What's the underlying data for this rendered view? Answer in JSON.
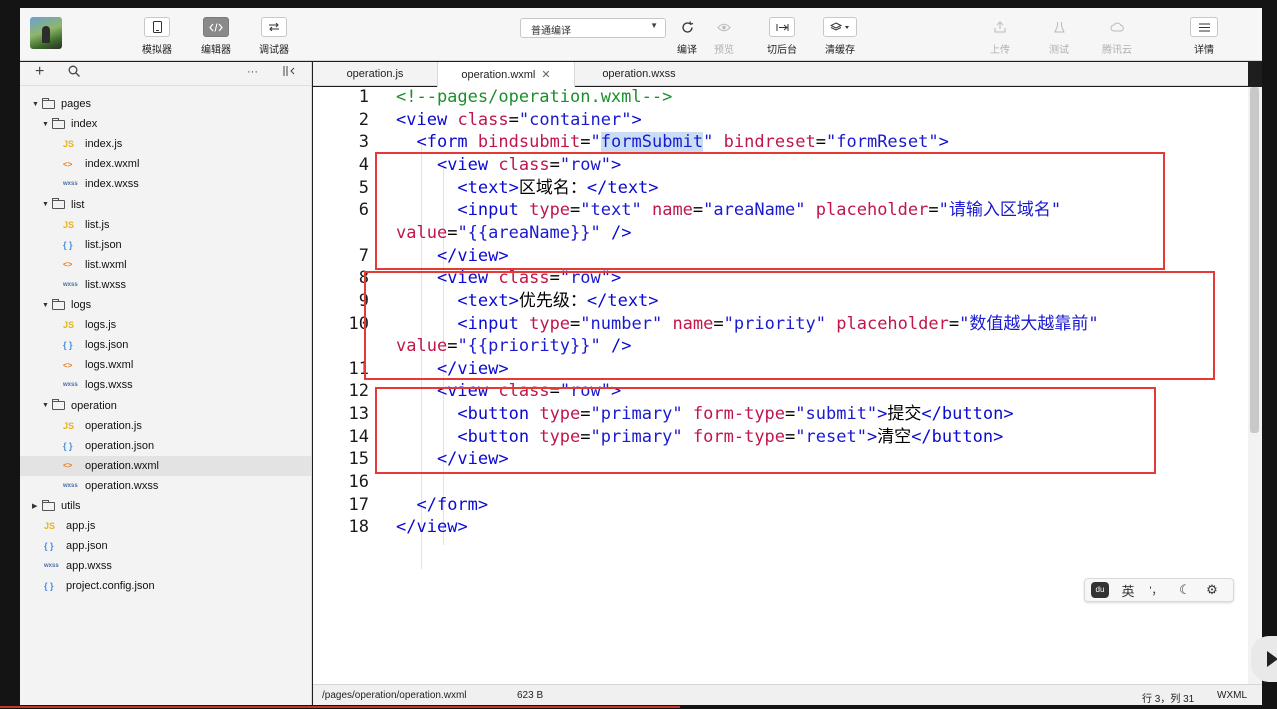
{
  "toolbar": {
    "buttons": [
      {
        "label": "模拟器",
        "icon": "phone-icon"
      },
      {
        "label": "编辑器",
        "icon": "code-icon"
      },
      {
        "label": "调试器",
        "icon": "debug-icon"
      },
      {
        "label": "编译",
        "icon": "refresh-icon"
      },
      {
        "label": "预览",
        "icon": "eye-icon"
      },
      {
        "label": "切后台",
        "icon": "switch-background-icon"
      },
      {
        "label": "清缓存",
        "icon": "layers-icon"
      },
      {
        "label": "上传",
        "icon": "upload-icon"
      },
      {
        "label": "测试",
        "icon": "flask-icon"
      },
      {
        "label": "腾讯云",
        "icon": "cloud-icon"
      },
      {
        "label": "详情",
        "icon": "menu-icon"
      }
    ],
    "compile_mode": "普通编译"
  },
  "sidebar": {
    "add_icon": "+",
    "search_icon": "search-icon",
    "more_icon": "···",
    "split_icon": "split-icon",
    "tree": [
      {
        "label": "pages",
        "type": "folder",
        "expanded": true
      },
      {
        "label": "index",
        "type": "folder",
        "expanded": true
      },
      {
        "label": "index.js",
        "type": "js"
      },
      {
        "label": "index.wxml",
        "type": "wxml"
      },
      {
        "label": "index.wxss",
        "type": "wxss"
      },
      {
        "label": "list",
        "type": "folder",
        "expanded": true
      },
      {
        "label": "list.js",
        "type": "js"
      },
      {
        "label": "list.json",
        "type": "json"
      },
      {
        "label": "list.wxml",
        "type": "wxml"
      },
      {
        "label": "list.wxss",
        "type": "wxss"
      },
      {
        "label": "logs",
        "type": "folder",
        "expanded": true
      },
      {
        "label": "logs.js",
        "type": "js"
      },
      {
        "label": "logs.json",
        "type": "json"
      },
      {
        "label": "logs.wxml",
        "type": "wxml"
      },
      {
        "label": "logs.wxss",
        "type": "wxss"
      },
      {
        "label": "operation",
        "type": "folder",
        "expanded": true
      },
      {
        "label": "operation.js",
        "type": "js"
      },
      {
        "label": "operation.json",
        "type": "json"
      },
      {
        "label": "operation.wxml",
        "type": "wxml",
        "selected": true
      },
      {
        "label": "operation.wxss",
        "type": "wxss"
      },
      {
        "label": "utils",
        "type": "folder",
        "expanded": false
      },
      {
        "label": "app.js",
        "type": "js"
      },
      {
        "label": "app.json",
        "type": "json"
      },
      {
        "label": "app.wxss",
        "type": "wxss"
      },
      {
        "label": "project.config.json",
        "type": "json"
      }
    ],
    "file_icon_text": {
      "js": "JS",
      "json": "{ }",
      "wxml": "<>",
      "wxss": "wxss"
    }
  },
  "tabs": [
    {
      "label": "operation.js",
      "active": false
    },
    {
      "label": "operation.wxml",
      "active": true,
      "close": "✕"
    },
    {
      "label": "operation.wxss",
      "active": false
    }
  ],
  "editor": {
    "line_numbers": [
      "1",
      "2",
      "3",
      "4",
      "5",
      "6",
      "",
      "7",
      "8",
      "9",
      "10",
      "",
      "11",
      "12",
      "13",
      "14",
      "15",
      "16",
      "17",
      "18"
    ],
    "lines": [
      [
        {
          "t": "<!--pages/operation.wxml-->",
          "c": "c"
        }
      ],
      [
        {
          "t": "<",
          "c": "t"
        },
        {
          "t": "view",
          "c": "t"
        },
        {
          "t": " ",
          "c": "p"
        },
        {
          "t": "class",
          "c": "a"
        },
        {
          "t": "=",
          "c": "p"
        },
        {
          "t": "\"container\"",
          "c": "s"
        },
        {
          "t": ">",
          "c": "t"
        }
      ],
      [
        {
          "t": "  <",
          "c": "t"
        },
        {
          "t": "form",
          "c": "t"
        },
        {
          "t": " ",
          "c": "p"
        },
        {
          "t": "bindsubmit",
          "c": "a"
        },
        {
          "t": "=",
          "c": "p"
        },
        {
          "t": "\"",
          "c": "s"
        },
        {
          "t": "formSubmit",
          "c": "sel"
        },
        {
          "t": "\"",
          "c": "s"
        },
        {
          "t": " ",
          "c": "p"
        },
        {
          "t": "bindreset",
          "c": "a"
        },
        {
          "t": "=",
          "c": "p"
        },
        {
          "t": "\"formReset\"",
          "c": "s"
        },
        {
          "t": ">",
          "c": "t"
        }
      ],
      [
        {
          "t": "    <",
          "c": "t"
        },
        {
          "t": "view",
          "c": "t"
        },
        {
          "t": " ",
          "c": "p"
        },
        {
          "t": "class",
          "c": "a"
        },
        {
          "t": "=",
          "c": "p"
        },
        {
          "t": "\"row\"",
          "c": "s"
        },
        {
          "t": ">",
          "c": "t"
        }
      ],
      [
        {
          "t": "      <",
          "c": "t"
        },
        {
          "t": "text",
          "c": "t"
        },
        {
          "t": ">",
          "c": "t"
        },
        {
          "t": "区域名：",
          "c": "p"
        },
        {
          "t": "</",
          "c": "t"
        },
        {
          "t": "text",
          "c": "t"
        },
        {
          "t": ">",
          "c": "t"
        }
      ],
      [
        {
          "t": "      <",
          "c": "t"
        },
        {
          "t": "input",
          "c": "t"
        },
        {
          "t": " ",
          "c": "p"
        },
        {
          "t": "type",
          "c": "a"
        },
        {
          "t": "=",
          "c": "p"
        },
        {
          "t": "\"text\"",
          "c": "s"
        },
        {
          "t": " ",
          "c": "p"
        },
        {
          "t": "name",
          "c": "a"
        },
        {
          "t": "=",
          "c": "p"
        },
        {
          "t": "\"areaName\"",
          "c": "s"
        },
        {
          "t": " ",
          "c": "p"
        },
        {
          "t": "placeholder",
          "c": "a"
        },
        {
          "t": "=",
          "c": "p"
        },
        {
          "t": "\"请输入区域名\"",
          "c": "s"
        }
      ],
      [
        {
          "t": "value",
          "c": "a"
        },
        {
          "t": "=",
          "c": "p"
        },
        {
          "t": "\"{{areaName}}\"",
          "c": "s"
        },
        {
          "t": " />",
          "c": "t"
        }
      ],
      [
        {
          "t": "    </",
          "c": "t"
        },
        {
          "t": "view",
          "c": "t"
        },
        {
          "t": ">",
          "c": "t"
        }
      ],
      [
        {
          "t": "    <",
          "c": "t"
        },
        {
          "t": "view",
          "c": "t"
        },
        {
          "t": " ",
          "c": "p"
        },
        {
          "t": "class",
          "c": "a"
        },
        {
          "t": "=",
          "c": "p"
        },
        {
          "t": "\"row\"",
          "c": "s"
        },
        {
          "t": ">",
          "c": "t"
        }
      ],
      [
        {
          "t": "      <",
          "c": "t"
        },
        {
          "t": "text",
          "c": "t"
        },
        {
          "t": ">",
          "c": "t"
        },
        {
          "t": "优先级：",
          "c": "p"
        },
        {
          "t": "</",
          "c": "t"
        },
        {
          "t": "text",
          "c": "t"
        },
        {
          "t": ">",
          "c": "t"
        }
      ],
      [
        {
          "t": "      <",
          "c": "t"
        },
        {
          "t": "input",
          "c": "t"
        },
        {
          "t": " ",
          "c": "p"
        },
        {
          "t": "type",
          "c": "a"
        },
        {
          "t": "=",
          "c": "p"
        },
        {
          "t": "\"number\"",
          "c": "s"
        },
        {
          "t": " ",
          "c": "p"
        },
        {
          "t": "name",
          "c": "a"
        },
        {
          "t": "=",
          "c": "p"
        },
        {
          "t": "\"priority\"",
          "c": "s"
        },
        {
          "t": " ",
          "c": "p"
        },
        {
          "t": "placeholder",
          "c": "a"
        },
        {
          "t": "=",
          "c": "p"
        },
        {
          "t": "\"数值越大越靠前\"",
          "c": "s"
        }
      ],
      [
        {
          "t": "value",
          "c": "a"
        },
        {
          "t": "=",
          "c": "p"
        },
        {
          "t": "\"{{priority}}\"",
          "c": "s"
        },
        {
          "t": " />",
          "c": "t"
        }
      ],
      [
        {
          "t": "    </",
          "c": "t"
        },
        {
          "t": "view",
          "c": "t"
        },
        {
          "t": ">",
          "c": "t"
        }
      ],
      [
        {
          "t": "    <",
          "c": "t"
        },
        {
          "t": "view",
          "c": "t"
        },
        {
          "t": " ",
          "c": "p"
        },
        {
          "t": "class",
          "c": "a"
        },
        {
          "t": "=",
          "c": "p"
        },
        {
          "t": "\"row\"",
          "c": "s"
        },
        {
          "t": ">",
          "c": "t"
        }
      ],
      [
        {
          "t": "      <",
          "c": "t"
        },
        {
          "t": "button",
          "c": "t"
        },
        {
          "t": " ",
          "c": "p"
        },
        {
          "t": "type",
          "c": "a"
        },
        {
          "t": "=",
          "c": "p"
        },
        {
          "t": "\"primary\"",
          "c": "s"
        },
        {
          "t": " ",
          "c": "p"
        },
        {
          "t": "form-type",
          "c": "a"
        },
        {
          "t": "=",
          "c": "p"
        },
        {
          "t": "\"submit\"",
          "c": "s"
        },
        {
          "t": ">",
          "c": "t"
        },
        {
          "t": "提交",
          "c": "p"
        },
        {
          "t": "</",
          "c": "t"
        },
        {
          "t": "button",
          "c": "t"
        },
        {
          "t": ">",
          "c": "t"
        }
      ],
      [
        {
          "t": "      <",
          "c": "t"
        },
        {
          "t": "button",
          "c": "t"
        },
        {
          "t": " ",
          "c": "p"
        },
        {
          "t": "type",
          "c": "a"
        },
        {
          "t": "=",
          "c": "p"
        },
        {
          "t": "\"primary\"",
          "c": "s"
        },
        {
          "t": " ",
          "c": "p"
        },
        {
          "t": "form-type",
          "c": "a"
        },
        {
          "t": "=",
          "c": "p"
        },
        {
          "t": "\"reset\"",
          "c": "s"
        },
        {
          "t": ">",
          "c": "t"
        },
        {
          "t": "清空",
          "c": "p"
        },
        {
          "t": "</",
          "c": "t"
        },
        {
          "t": "button",
          "c": "t"
        },
        {
          "t": ">",
          "c": "t"
        }
      ],
      [
        {
          "t": "    </",
          "c": "t"
        },
        {
          "t": "view",
          "c": "t"
        },
        {
          "t": ">",
          "c": "t"
        }
      ],
      [
        {
          "t": "",
          "c": "p"
        }
      ],
      [
        {
          "t": "  </",
          "c": "t"
        },
        {
          "t": "form",
          "c": "t"
        },
        {
          "t": ">",
          "c": "t"
        }
      ],
      [
        {
          "t": "</",
          "c": "t"
        },
        {
          "t": "view",
          "c": "t"
        },
        {
          "t": ">",
          "c": "t"
        }
      ]
    ]
  },
  "statusbar": {
    "path": "/pages/operation/operation.wxml",
    "size": "623 B",
    "cursor": "行 3，列 31",
    "language": "WXML"
  },
  "ime": {
    "logo": "du",
    "lang": "英",
    "punct": "'，",
    "moon": "☾",
    "gear": "⚙"
  },
  "colors": {
    "highlight_box": "#e53935",
    "comment": "#1a8f2a",
    "tag": "#0a0ad0",
    "attr": "#c0164a",
    "string": "#1a1ad0"
  }
}
